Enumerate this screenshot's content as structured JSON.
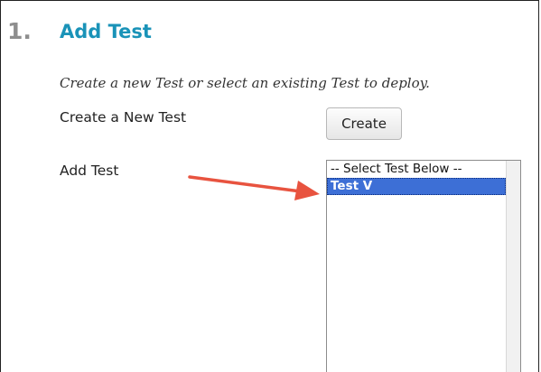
{
  "step": {
    "number": "1.",
    "title": "Add Test",
    "instructions": "Create a new Test or select an existing Test to deploy."
  },
  "create_row": {
    "label": "Create a New Test",
    "button_label": "Create"
  },
  "add_row": {
    "label": "Add Test",
    "options": [
      "-- Select Test Below --",
      "Test V"
    ],
    "selected_option": "Test V"
  },
  "colors": {
    "title": "#1a93b8",
    "selection": "#3d6fd6",
    "arrow": "#e8533f"
  }
}
